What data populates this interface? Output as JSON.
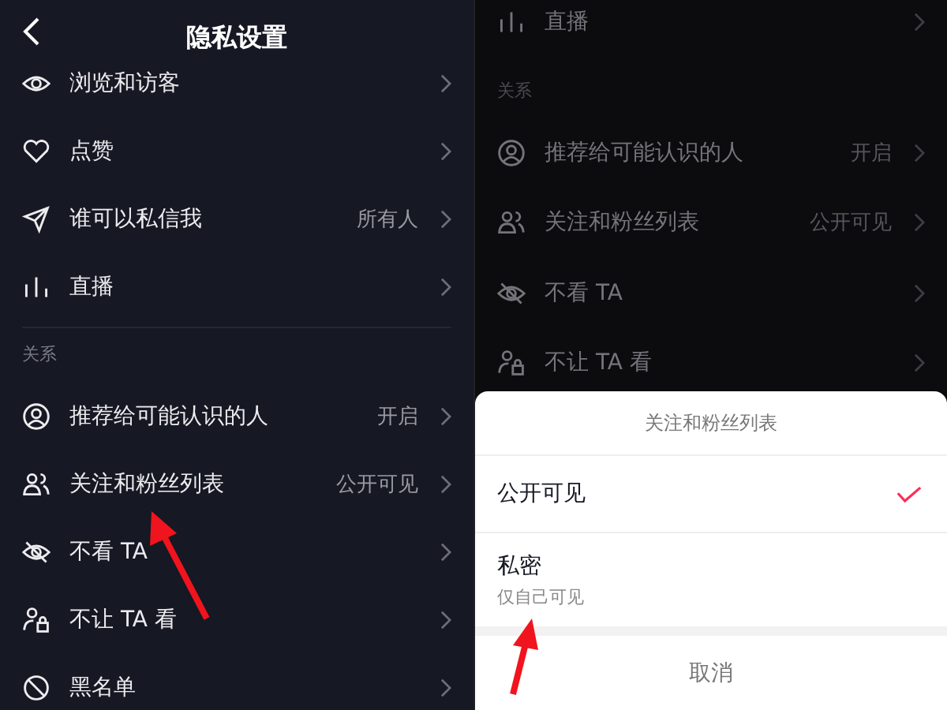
{
  "left_screen": {
    "title": "隐私设置",
    "groups": [
      {
        "rows": [
          {
            "kind": "eye",
            "label": "浏览和访客"
          },
          {
            "kind": "heart",
            "label": "点赞"
          },
          {
            "kind": "send",
            "label": "谁可以私信我",
            "value": "所有人"
          },
          {
            "kind": "bars",
            "label": "直播"
          }
        ]
      },
      {
        "header": "关系",
        "rows": [
          {
            "kind": "person",
            "label": "推荐给可能认识的人",
            "value": "开启"
          },
          {
            "kind": "people",
            "label": "关注和粉丝列表",
            "value": "公开可见"
          },
          {
            "kind": "eyeoff",
            "label": "不看 TA"
          },
          {
            "kind": "lock",
            "label": "不让 TA 看"
          },
          {
            "kind": "block",
            "label": "黑名单"
          }
        ]
      }
    ]
  },
  "right_screen": {
    "groups": [
      {
        "rows": [
          {
            "kind": "bars",
            "label": "直播"
          }
        ]
      },
      {
        "header": "关系",
        "rows": [
          {
            "kind": "person",
            "label": "推荐给可能认识的人",
            "value": "开启"
          },
          {
            "kind": "people",
            "label": "关注和粉丝列表",
            "value": "公开可见"
          },
          {
            "kind": "eyeoff",
            "label": "不看 TA"
          },
          {
            "kind": "lock",
            "label": "不让 TA 看"
          }
        ]
      }
    ],
    "sheet": {
      "title": "关注和粉丝列表",
      "options": [
        {
          "label": "公开可见",
          "selected": true
        },
        {
          "label": "私密",
          "note": "仅自己可见",
          "selected": false
        }
      ],
      "cancel": "取消"
    }
  }
}
